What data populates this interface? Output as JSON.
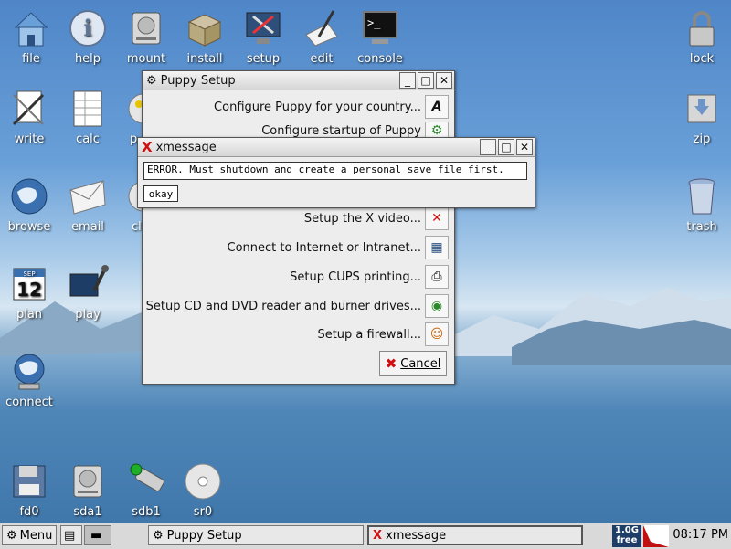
{
  "desktop": {
    "icons": [
      {
        "label": "file",
        "icon": "home-folder-icon"
      },
      {
        "label": "help",
        "icon": "info-icon"
      },
      {
        "label": "mount",
        "icon": "drive-icon"
      },
      {
        "label": "install",
        "icon": "package-box-icon"
      },
      {
        "label": "setup",
        "icon": "tools-icon"
      },
      {
        "label": "edit",
        "icon": "pen-paper-icon"
      },
      {
        "label": "console",
        "icon": "terminal-icon"
      },
      {
        "label": "lock",
        "icon": "padlock-icon"
      },
      {
        "label": "write",
        "icon": "writer-icon"
      },
      {
        "label": "calc",
        "icon": "spreadsheet-icon"
      },
      {
        "label": "zip",
        "icon": "archive-icon"
      },
      {
        "label": "browse",
        "icon": "globe-icon"
      },
      {
        "label": "email",
        "icon": "envelope-icon"
      },
      {
        "label": "trash",
        "icon": "trash-can-icon"
      },
      {
        "label": "plan",
        "icon": "calendar-icon",
        "badge": "12",
        "month": "SEP"
      },
      {
        "label": "play",
        "icon": "media-icon"
      },
      {
        "label": "connect",
        "icon": "network-globe-icon"
      },
      {
        "label": "fd0",
        "icon": "floppy-icon"
      },
      {
        "label": "sda1",
        "icon": "hard-disk-icon"
      },
      {
        "label": "sdb1",
        "icon": "usb-stick-icon"
      },
      {
        "label": "sr0",
        "icon": "cdrom-icon"
      }
    ],
    "partial_labels": [
      "p",
      "cl"
    ]
  },
  "setup_window": {
    "title": "Puppy Setup",
    "rows": [
      {
        "label": "Configure Puppy for your country...",
        "icon": "A"
      },
      {
        "label": "Configure startup of Puppy",
        "icon": "⚙"
      },
      {
        "label": "Setup the X video...",
        "icon": "✕"
      },
      {
        "label": "Connect to Internet or Intranet...",
        "icon": "▦"
      },
      {
        "label": "Setup CUPS printing...",
        "icon": "⎙"
      },
      {
        "label": "Setup CD and DVD reader and burner drives...",
        "icon": "◉"
      },
      {
        "label": "Setup a firewall...",
        "icon": "☺"
      }
    ],
    "cancel_label": "Cancel"
  },
  "xmessage": {
    "title": "xmessage",
    "message": "ERROR. Must shutdown and create a personal save file first.",
    "okay_label": "okay"
  },
  "taskbar": {
    "menu_label": "Menu",
    "tasks": [
      {
        "label": "Puppy Setup"
      },
      {
        "label": "xmessage"
      }
    ],
    "free_size": "1.0G",
    "free_label": "free",
    "clock": "08:17 PM"
  },
  "colors": {
    "error_red": "#d01010",
    "accent_blue": "#3a6fb0"
  }
}
